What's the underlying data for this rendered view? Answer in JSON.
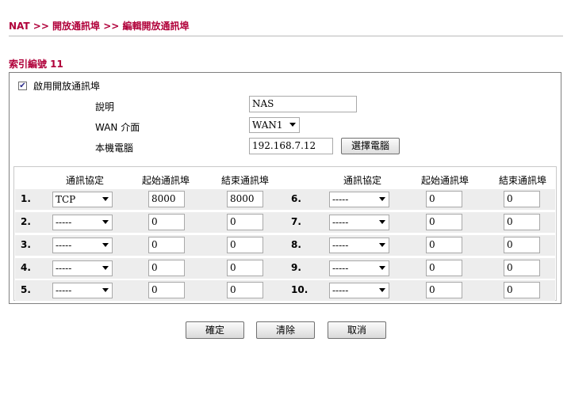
{
  "breadcrumb": "NAT >> 開放通訊埠 >> 編輯開放通訊埠",
  "index_title": "索引編號 11",
  "form": {
    "enable_label": "啟用開放通訊埠",
    "enable_checked": true,
    "comment_label": "說明",
    "comment_value": "NAS",
    "wan_label": "WAN 介面",
    "wan_value": "WAN1",
    "local_pc_label": "本機電腦",
    "local_pc_value": "192.168.7.12",
    "select_pc_button": "選擇電腦"
  },
  "table": {
    "headers": [
      "通訊協定",
      "起始通訊埠",
      "結束通訊埠",
      "通訊協定",
      "起始通訊埠",
      "結束通訊埠"
    ],
    "rows": [
      {
        "num": "1.",
        "protocol": "TCP",
        "start": "8000",
        "end": "8000"
      },
      {
        "num": "2.",
        "protocol": "-----",
        "start": "0",
        "end": "0"
      },
      {
        "num": "3.",
        "protocol": "-----",
        "start": "0",
        "end": "0"
      },
      {
        "num": "4.",
        "protocol": "-----",
        "start": "0",
        "end": "0"
      },
      {
        "num": "5.",
        "protocol": "-----",
        "start": "0",
        "end": "0"
      },
      {
        "num": "6.",
        "protocol": "-----",
        "start": "0",
        "end": "0"
      },
      {
        "num": "7.",
        "protocol": "-----",
        "start": "0",
        "end": "0"
      },
      {
        "num": "8.",
        "protocol": "-----",
        "start": "0",
        "end": "0"
      },
      {
        "num": "9.",
        "protocol": "-----",
        "start": "0",
        "end": "0"
      },
      {
        "num": "10.",
        "protocol": "-----",
        "start": "0",
        "end": "0"
      }
    ]
  },
  "buttons": {
    "ok": "確定",
    "clear": "清除",
    "cancel": "取消"
  },
  "colors": {
    "title": "#b0003a",
    "row_bg": "#ededed",
    "border": "#7f7f7f"
  }
}
